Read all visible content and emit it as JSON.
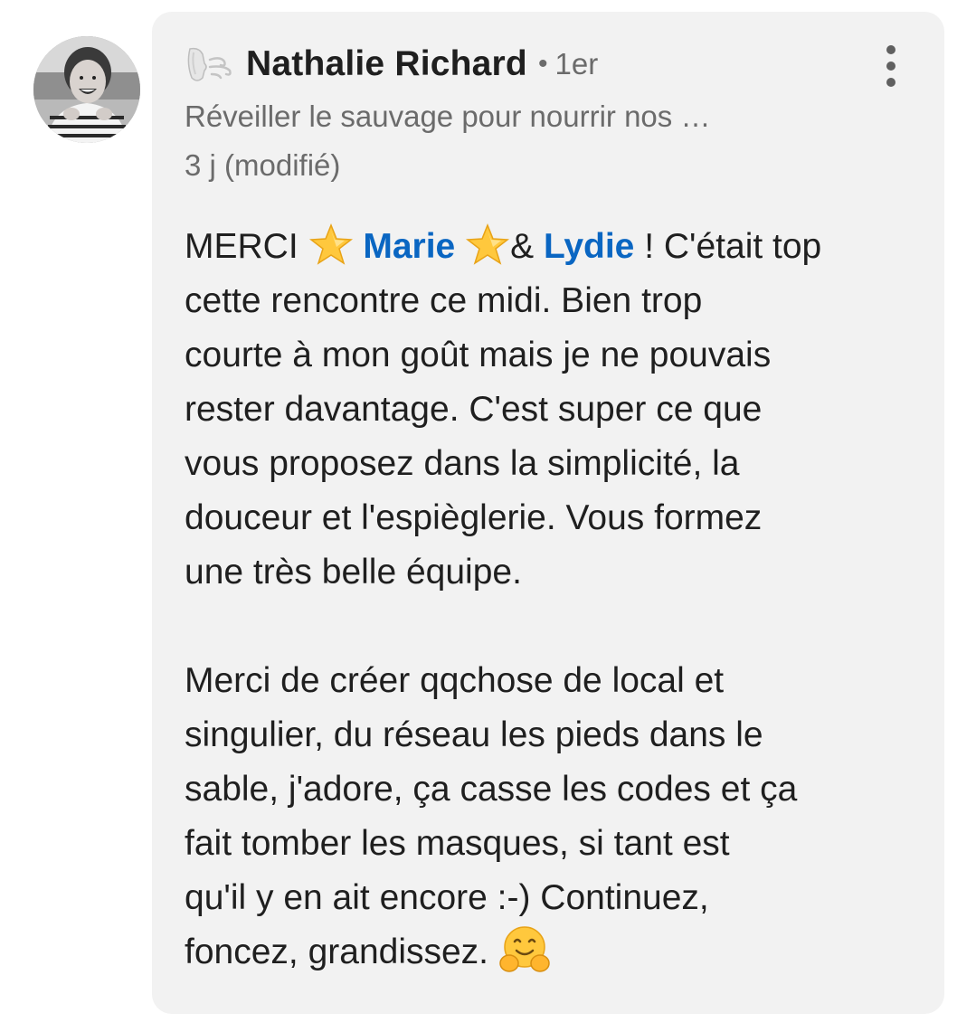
{
  "comment": {
    "author_name": "Nathalie Richard",
    "separator": "•",
    "connection_degree": "1er",
    "headline": "Réveiller le sauvage pour nourrir nos …",
    "time": "3 j (modifié)",
    "avatar_icon": "profile-photo",
    "badge_icon": "wind-face-icon",
    "menu_icon": "more-vertical-icon",
    "body": {
      "p1_start": "MERCI ",
      "star_icon": "star-emoji",
      "mention_1": "Marie",
      "p1_amp": "& ",
      "mention_2": "Lydie",
      "p1_rest": " ! C'était top\ncette rencontre ce midi. Bien trop\ncourte à mon goût mais je ne pouvais\nrester davantage. C'est super ce que\nvous proposez dans la simplicité, la\ndouceur et l'espièglerie. Vous formez\nune très belle équipe.",
      "p2": "Merci de créer qqchose de local et\nsingulier, du réseau les pieds dans le\nsable, j'adore, ça casse les codes et ça\nfait tomber les masques, si tant est\nqu'il y en ait  encore :-) Continuez,\nfoncez, grandissez. ",
      "hug_icon": "hugging-face-emoji"
    }
  },
  "colors": {
    "bubble_bg": "#f2f2f2",
    "mention": "#0a66c2",
    "text_primary": "#1f1f1f",
    "text_secondary": "#6b6b6b"
  }
}
